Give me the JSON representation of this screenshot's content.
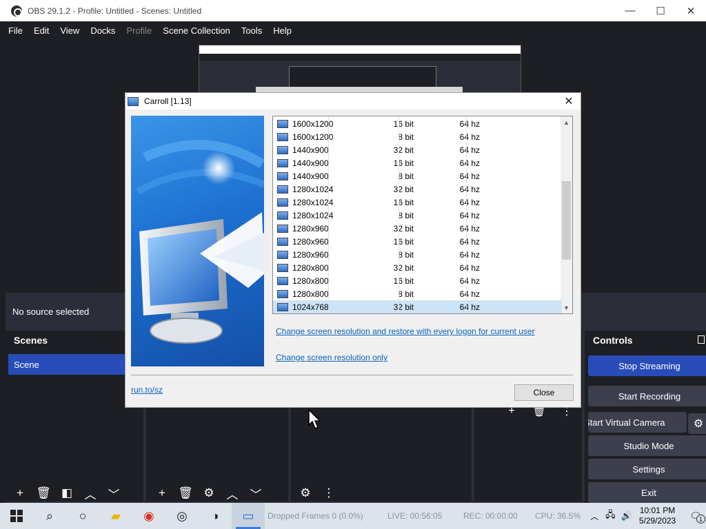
{
  "obs": {
    "window_title": "OBS 29.1.2 - Profile: Untitled - Scenes: Untitled",
    "window_controls": {
      "minimize": "—",
      "maximize": "☐",
      "close": "✕"
    },
    "menu": [
      {
        "label": "File",
        "disabled": false
      },
      {
        "label": "Edit",
        "disabled": false
      },
      {
        "label": "View",
        "disabled": false
      },
      {
        "label": "Docks",
        "disabled": false
      },
      {
        "label": "Profile",
        "disabled": true
      },
      {
        "label": "Scene Collection",
        "disabled": false
      },
      {
        "label": "Tools",
        "disabled": false
      },
      {
        "label": "Help",
        "disabled": false
      }
    ],
    "no_source_text": "No source selected",
    "scenes_header": "Scenes",
    "scene_item": "Scene",
    "controls_header": "Controls",
    "controls": {
      "stop_streaming": "Stop Streaming",
      "start_recording": "Start Recording",
      "start_virtual_camera": "Start Virtual Camera",
      "studio_mode": "Studio Mode",
      "settings": "Settings",
      "exit": "Exit"
    },
    "status": {
      "dropped_frames": "Dropped Frames 0 (0.0%)",
      "live": "LIVE: 00:56:05",
      "rec": "REC: 00:00:00",
      "cpu": "CPU: 36.5%"
    }
  },
  "dialog": {
    "title": "Carroll [1.13]",
    "close_glyph": "✕",
    "resolutions": [
      {
        "name": "1600x1200",
        "bits": "16 bit",
        "hz": "64 hz",
        "selected": false
      },
      {
        "name": "1600x1200",
        "bits": "8 bit",
        "hz": "64 hz",
        "selected": false
      },
      {
        "name": "1440x900",
        "bits": "32 bit",
        "hz": "64 hz",
        "selected": false
      },
      {
        "name": "1440x900",
        "bits": "16 bit",
        "hz": "64 hz",
        "selected": false
      },
      {
        "name": "1440x900",
        "bits": "8 bit",
        "hz": "64 hz",
        "selected": false
      },
      {
        "name": "1280x1024",
        "bits": "32 bit",
        "hz": "64 hz",
        "selected": false
      },
      {
        "name": "1280x1024",
        "bits": "16 bit",
        "hz": "64 hz",
        "selected": false
      },
      {
        "name": "1280x1024",
        "bits": "8 bit",
        "hz": "64 hz",
        "selected": false
      },
      {
        "name": "1280x960",
        "bits": "32 bit",
        "hz": "64 hz",
        "selected": false
      },
      {
        "name": "1280x960",
        "bits": "16 bit",
        "hz": "64 hz",
        "selected": false
      },
      {
        "name": "1280x960",
        "bits": "8 bit",
        "hz": "64 hz",
        "selected": false
      },
      {
        "name": "1280x800",
        "bits": "32 bit",
        "hz": "64 hz",
        "selected": false
      },
      {
        "name": "1280x800",
        "bits": "16 bit",
        "hz": "64 hz",
        "selected": false
      },
      {
        "name": "1280x800",
        "bits": "8 bit",
        "hz": "64 hz",
        "selected": false
      },
      {
        "name": "1024x768",
        "bits": "32 bit",
        "hz": "64 hz",
        "selected": true
      }
    ],
    "link_restore": "Change screen resolution and restore with every logon for current user",
    "link_only": "Change screen resolution only",
    "footer_link": "run.to/sz",
    "close_button": "Close"
  },
  "taskbar": {
    "time": "10:01 PM",
    "date": "5/29/2023",
    "notification_count": "1"
  }
}
